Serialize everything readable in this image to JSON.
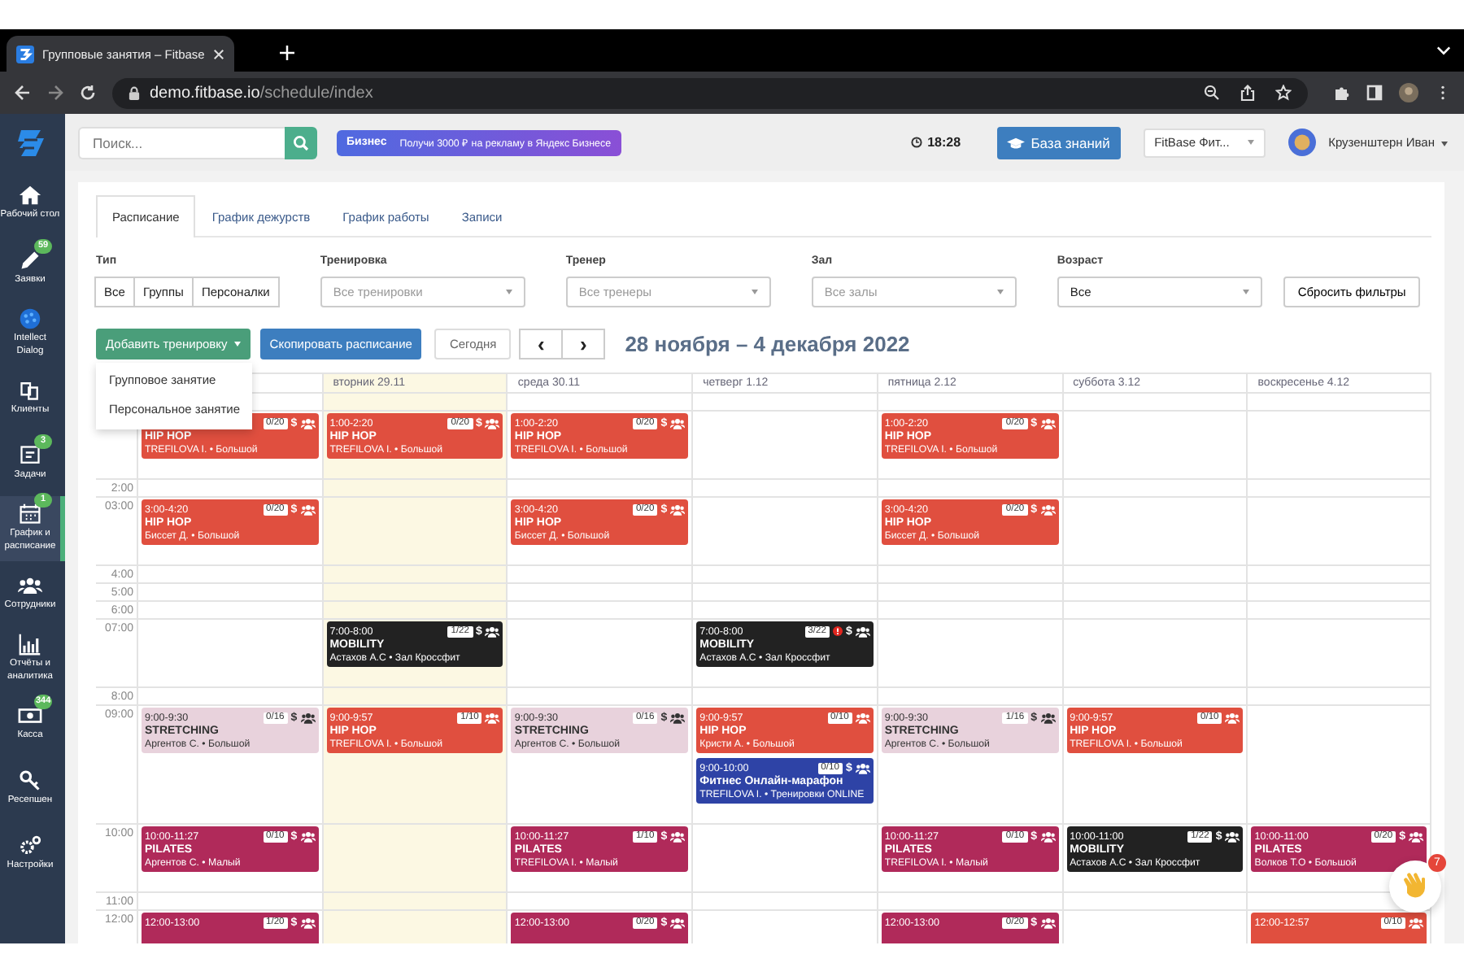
{
  "browser": {
    "tab_title": "Групповые занятия – Fitbase",
    "url_host": "demo.fitbase.io",
    "url_path": "/schedule/index"
  },
  "header": {
    "search_placeholder": "Поиск...",
    "ad_brand": "Бизнес",
    "ad_text": "Получи 3000 ₽ на рекламу в Яндекс Бизнесе",
    "time": "18:28",
    "kb_button": "База знаний",
    "club_select": "FitBase Фит...",
    "user": "Крузенштерн Иван"
  },
  "sidebar": {
    "items": [
      {
        "label": "Рабочий стол",
        "selected": false
      },
      {
        "label": "Заявки",
        "badge": "59",
        "selected": false
      },
      {
        "label": "Intellect Dialog",
        "selected": false
      },
      {
        "label": "Клиенты",
        "selected": false
      },
      {
        "label": "Задачи",
        "badge": "3",
        "selected": false
      },
      {
        "label": "График и расписание",
        "badge": "1",
        "selected": true
      },
      {
        "label": "Сотрудники",
        "selected": false
      },
      {
        "label": "Отчёты и аналитика",
        "selected": false
      },
      {
        "label": "Касса",
        "badge": "344",
        "selected": false
      },
      {
        "label": "Ресепшен",
        "selected": false
      },
      {
        "label": "Настройки",
        "selected": false
      }
    ]
  },
  "tabs": [
    {
      "label": "Расписание",
      "selected": true
    },
    {
      "label": "График дежурств",
      "selected": false
    },
    {
      "label": "График работы",
      "selected": false
    },
    {
      "label": "Записи",
      "selected": false
    }
  ],
  "filters": {
    "type_label": "Тип",
    "type_options": [
      "Все",
      "Группы",
      "Персоналки"
    ],
    "selects": [
      {
        "label": "Тренировка",
        "placeholder": "Все тренировки"
      },
      {
        "label": "Тренер",
        "placeholder": "Все тренеры"
      },
      {
        "label": "Зал",
        "placeholder": "Все залы"
      },
      {
        "label": "Возраст",
        "value": "Все"
      }
    ],
    "reset_button": "Сбросить фильтры"
  },
  "toolbar": {
    "add_button": "Добавить тренировку",
    "copy_button": "Скопировать расписание",
    "today_button": "Сегодня",
    "prev": "‹",
    "next": "›",
    "period": "28 ноября – 4 декабря 2022"
  },
  "add_menu": [
    "Групповое занятие",
    "Персональное занятие"
  ],
  "days": [
    {
      "label": "вторник 29.11",
      "today": true
    },
    {
      "label": "среда 30.11",
      "today": false
    },
    {
      "label": "четверг 1.12",
      "today": false
    },
    {
      "label": "пятница 2.12",
      "today": false
    },
    {
      "label": "суббота 3.12",
      "today": false
    },
    {
      "label": "воскресенье 4.12",
      "today": false
    }
  ],
  "rows": [
    {
      "cells": [
        {},
        {},
        {},
        {},
        {},
        {},
        {}
      ]
    },
    {
      "cells": [
        {
          "events": [
            {
              "count": "0/20",
              "price": "$",
              "title": "HIP HOP",
              "info": "TREFILOVA I. • Большой",
              "color": "#e04f3f"
            }
          ]
        },
        {
          "events": [
            {
              "time": "1:00-2:20",
              "count": "0/20",
              "price": "$",
              "title": "HIP HOP",
              "info": "TREFILOVA I. • Большой",
              "color": "#e04f3f"
            }
          ]
        },
        {
          "events": [
            {
              "time": "1:00-2:20",
              "count": "0/20",
              "price": "$",
              "title": "HIP HOP",
              "info": "TREFILOVA I. • Большой",
              "color": "#e04f3f"
            }
          ]
        },
        {},
        {
          "events": [
            {
              "time": "1:00-2:20",
              "count": "0/20",
              "price": "$",
              "title": "HIP HOP",
              "info": "TREFILOVA I. • Большой",
              "color": "#e04f3f"
            }
          ]
        },
        {},
        {}
      ]
    },
    {
      "time": "2:00",
      "cells": [
        {},
        {},
        {},
        {},
        {},
        {},
        {}
      ]
    },
    {
      "time": "03:00",
      "cells": [
        {
          "events": [
            {
              "time": "3:00-4:20",
              "count": "0/20",
              "price": "$",
              "title": "HIP HOP",
              "info": "Биссет Д. • Большой",
              "color": "#e04f3f"
            }
          ]
        },
        {},
        {
          "events": [
            {
              "time": "3:00-4:20",
              "count": "0/20",
              "price": "$",
              "title": "HIP HOP",
              "info": "Биссет Д. • Большой",
              "color": "#e04f3f"
            }
          ]
        },
        {},
        {
          "events": [
            {
              "time": "3:00-4:20",
              "count": "0/20",
              "price": "$",
              "title": "HIP HOP",
              "info": "Биссет Д. • Большой",
              "color": "#e04f3f"
            }
          ]
        },
        {},
        {}
      ]
    },
    {
      "time": "4:00",
      "cells": [
        {},
        {},
        {},
        {},
        {},
        {},
        {}
      ]
    },
    {
      "time": "5:00",
      "cells": [
        {},
        {},
        {},
        {},
        {},
        {},
        {}
      ]
    },
    {
      "time": "6:00",
      "cells": [
        {},
        {},
        {},
        {},
        {},
        {},
        {}
      ]
    },
    {
      "time": "07:00",
      "cells": [
        {},
        {
          "events": [
            {
              "time": "7:00-8:00",
              "count": "1/22",
              "price": "$",
              "title": "MOBILITY",
              "info": "Астахов А.С • Зал Кроссфит",
              "color": "#222222"
            }
          ]
        },
        {},
        {
          "events": [
            {
              "time": "7:00-8:00",
              "count": "3/22",
              "warning": true,
              "price": "$",
              "title": "MOBILITY",
              "info": "Астахов А.С • Зал Кроссфит",
              "color": "#222222"
            }
          ]
        },
        {},
        {},
        {}
      ]
    },
    {
      "time": "8:00",
      "cells": [
        {},
        {},
        {},
        {},
        {},
        {},
        {}
      ]
    },
    {
      "time": "09:00",
      "cells": [
        {
          "events": [
            {
              "time": "9:00-9:30",
              "count": "0/16",
              "price": "$",
              "title": "STRETCHING",
              "info": "Аргентов С. • Большой",
              "color": "#e8d2dc"
            }
          ]
        },
        {
          "events": [
            {
              "time": "9:00-9:57",
              "count": "1/10",
              "title": "HIP HOP",
              "info": "TREFILOVA I. • Большой",
              "color": "#e04f3f"
            }
          ]
        },
        {
          "events": [
            {
              "time": "9:00-9:30",
              "count": "0/16",
              "price": "$",
              "title": "STRETCHING",
              "info": "Аргентов С. • Большой",
              "color": "#e8d2dc"
            }
          ]
        },
        {
          "events": [
            {
              "time": "9:00-9:57",
              "count": "0/10",
              "title": "HIP HOP",
              "info": "Кристи А. • Большой",
              "color": "#e04f3f"
            },
            {
              "time": "9:00-10:00",
              "count": "0/10",
              "price": "$",
              "title": "Фитнес Онлайн-марафон",
              "info": "TREFILOVA I. • Тренировки ONLINE",
              "color": "#2e43a6"
            }
          ]
        },
        {
          "events": [
            {
              "time": "9:00-9:30",
              "count": "1/16",
              "price": "$",
              "title": "STRETCHING",
              "info": "Аргентов С. • Большой",
              "color": "#e8d2dc"
            }
          ]
        },
        {
          "events": [
            {
              "time": "9:00-9:57",
              "count": "0/10",
              "title": "HIP HOP",
              "info": "TREFILOVA I. • Большой",
              "color": "#e04f3f"
            }
          ]
        },
        {}
      ]
    },
    {
      "time": "10:00",
      "cells": [
        {
          "events": [
            {
              "time": "10:00-11:27",
              "count": "0/10",
              "price": "$",
              "title": "PILATES",
              "info": "Аргентов С. • Малый",
              "color": "#b02a5a"
            }
          ]
        },
        {},
        {
          "events": [
            {
              "time": "10:00-11:27",
              "count": "1/10",
              "price": "$",
              "title": "PILATES",
              "info": "TREFILOVA I. • Малый",
              "color": "#b02a5a"
            }
          ]
        },
        {},
        {
          "events": [
            {
              "time": "10:00-11:27",
              "count": "0/10",
              "price": "$",
              "title": "PILATES",
              "info": "TREFILOVA I. • Малый",
              "color": "#b02a5a"
            }
          ]
        },
        {
          "events": [
            {
              "time": "10:00-11:00",
              "count": "1/22",
              "price": "$",
              "title": "MOBILITY",
              "info": "Астахов А.С • Зал Кроссфит",
              "color": "#222222"
            }
          ]
        },
        {
          "events": [
            {
              "time": "10:00-11:00",
              "count": "0/20",
              "price": "$",
              "title": "PILATES",
              "info": "Волков Т.О • Большой",
              "color": "#b02a5a"
            }
          ]
        }
      ]
    },
    {
      "time": "11:00",
      "cells": [
        {},
        {},
        {},
        {},
        {},
        {},
        {}
      ]
    },
    {
      "time": "12:00",
      "cells": [
        {
          "events": [
            {
              "time": "12:00-13:00",
              "count": "1/20",
              "price": "$",
              "color": "#b02a5a"
            }
          ]
        },
        {},
        {
          "events": [
            {
              "time": "12:00-13:00",
              "count": "0/20",
              "price": "$",
              "color": "#b02a5a"
            }
          ]
        },
        {},
        {
          "events": [
            {
              "time": "12:00-13:00",
              "count": "0/20",
              "price": "$",
              "color": "#b02a5a"
            }
          ]
        },
        {},
        {
          "events": [
            {
              "time": "12:00-12:57",
              "count": "0/10",
              "color": "#e04f3f"
            }
          ]
        }
      ]
    }
  ],
  "chat": {
    "badge": "7"
  }
}
